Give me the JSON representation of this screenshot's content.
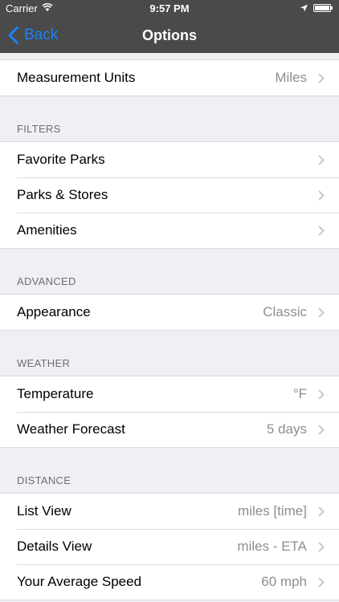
{
  "status": {
    "carrier": "Carrier",
    "time": "9:57 PM"
  },
  "nav": {
    "back_label": "Back",
    "title": "Options"
  },
  "general": [
    {
      "label": "Measurement Units",
      "value": "Miles"
    }
  ],
  "filters": {
    "header": "FILTERS",
    "items": [
      {
        "label": "Favorite Parks",
        "value": ""
      },
      {
        "label": "Parks & Stores",
        "value": ""
      },
      {
        "label": "Amenities",
        "value": ""
      }
    ]
  },
  "advanced": {
    "header": "ADVANCED",
    "items": [
      {
        "label": "Appearance",
        "value": "Classic"
      }
    ]
  },
  "weather": {
    "header": "WEATHER",
    "items": [
      {
        "label": "Temperature",
        "value": "°F"
      },
      {
        "label": "Weather Forecast",
        "value": "5 days"
      }
    ]
  },
  "distance": {
    "header": "DISTANCE",
    "items": [
      {
        "label": "List View",
        "value": "miles [time]"
      },
      {
        "label": "Details View",
        "value": "miles - ETA"
      },
      {
        "label": "Your Average Speed",
        "value": "60 mph"
      }
    ]
  }
}
